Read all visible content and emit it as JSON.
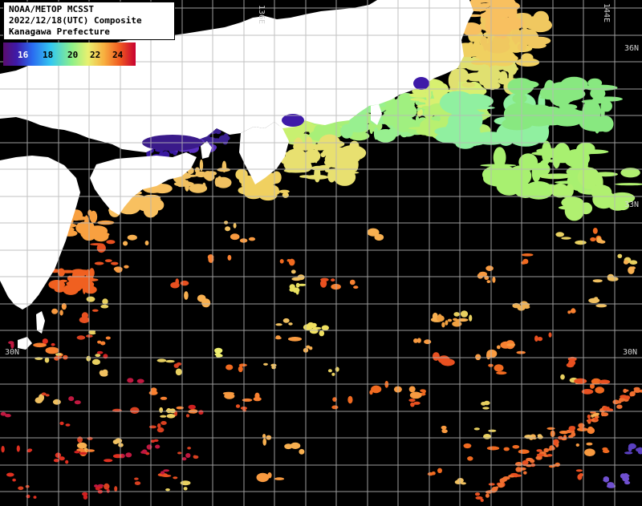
{
  "title": {
    "line1": "NOAA/METOP MCSST",
    "line2": "2022/12/18(UTC) Composite",
    "line3": "Kanagawa Prefecture"
  },
  "legend": {
    "labels": [
      "16",
      "18",
      "20",
      "22",
      "24"
    ],
    "colors": [
      "#5a0d6e",
      "#2a6bf0",
      "#33c8f0",
      "#8ef088",
      "#e8f070",
      "#f8b040",
      "#f05a20",
      "#c80030"
    ]
  },
  "coords": {
    "lon1": "136E",
    "lon2": "144E",
    "lat1_left": "",
    "lat1_right": "36N",
    "lat2_left": "",
    "lat2_right": "33N",
    "lat3_left": "30N",
    "lat3_right": "30N"
  },
  "colors": {
    "land": "#ffffff",
    "grid": "#b8b8b8",
    "sea_cloud": "#000000"
  }
}
